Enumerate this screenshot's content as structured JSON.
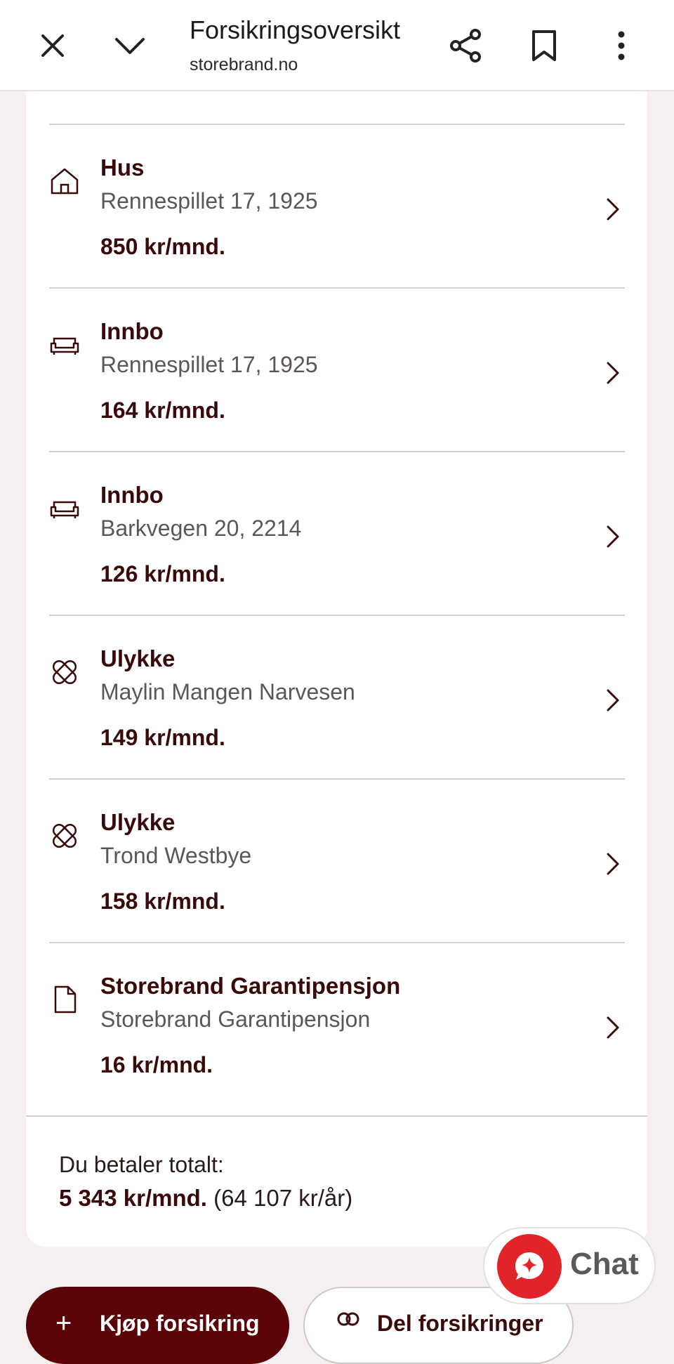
{
  "browser": {
    "title": "Forsikringsoversikt",
    "url": "storebrand.no"
  },
  "insurances": [
    {
      "icon": "house-icon",
      "title": "Hus",
      "subtitle": "Rennespillet 17, 1925",
      "price": "850 kr/mnd."
    },
    {
      "icon": "sofa-icon",
      "title": "Innbo",
      "subtitle": "Rennespillet 17, 1925",
      "price": "164 kr/mnd."
    },
    {
      "icon": "sofa-icon",
      "title": "Innbo",
      "subtitle": "Barkvegen 20, 2214",
      "price": "126 kr/mnd."
    },
    {
      "icon": "bandage-icon",
      "title": "Ulykke",
      "subtitle": "Maylin Mangen Narvesen",
      "price": "149 kr/mnd."
    },
    {
      "icon": "bandage-icon",
      "title": "Ulykke",
      "subtitle": "Trond Westbye",
      "price": "158 kr/mnd."
    },
    {
      "icon": "document-icon",
      "title": "Storebrand Garantipensjon",
      "subtitle": "Storebrand Garantipensjon",
      "price": "16 kr/mnd."
    }
  ],
  "total": {
    "label": "Du betaler totalt:",
    "monthly": "5 343 kr/mnd.",
    "yearly": "(64 107 kr/år)"
  },
  "chat": {
    "label": "Chat"
  },
  "actions": {
    "buy_label": "Kjøp forsikring",
    "share_label": "Del forsikringer"
  },
  "colors": {
    "brand": "#5a0408",
    "chat": "#e0242a",
    "text": "#3a0a0a"
  }
}
